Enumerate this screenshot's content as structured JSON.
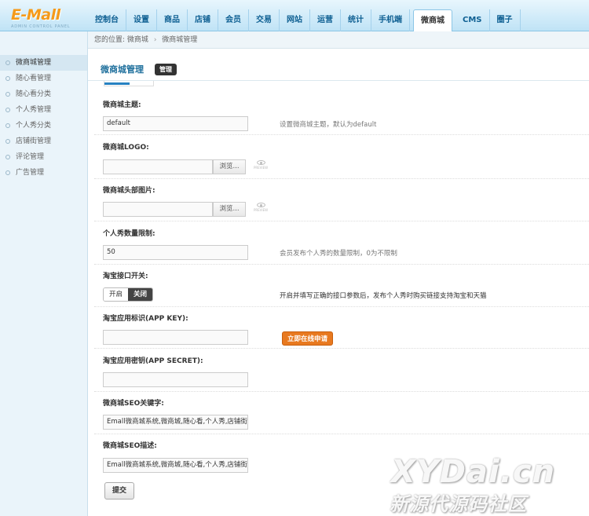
{
  "brand": {
    "logo": "E-Mall",
    "tagline": "ADMIN CONTROL PANEL"
  },
  "nav": {
    "items": [
      "控制台",
      "设置",
      "商品",
      "店铺",
      "会员",
      "交易",
      "网站",
      "运营",
      "统计",
      "手机端",
      "微商城",
      "CMS",
      "圈子"
    ],
    "active": "微商城"
  },
  "breadcrumb": {
    "prefix": "您的位置:",
    "level1": "微商城",
    "separator": "›",
    "level2": "微商城管理"
  },
  "sidebar": {
    "items": [
      {
        "label": "微商城管理",
        "active": true
      },
      {
        "label": "随心看管理"
      },
      {
        "label": "随心看分类"
      },
      {
        "label": "个人秀管理"
      },
      {
        "label": "个人秀分类"
      },
      {
        "label": "店铺街管理"
      },
      {
        "label": "评论管理"
      },
      {
        "label": "广告管理"
      }
    ]
  },
  "page": {
    "title": "微商城管理",
    "tab": "管理"
  },
  "form": {
    "theme": {
      "label": "微商城主题:",
      "value": "default",
      "tip": "设置微商城主题，默认为default"
    },
    "logo": {
      "label": "微商城LOGO:",
      "browse": "浏览...",
      "preview": "PREVIEW"
    },
    "header_image": {
      "label": "微商城头部图片:",
      "browse": "浏览...",
      "preview": "PREVIEW"
    },
    "show_limit": {
      "label": "个人秀数量限制:",
      "value": "50",
      "tip": "会员发布个人秀的数量限制，0为不限制"
    },
    "taobao_switch": {
      "label": "淘宝接口开关:",
      "on_label": "开启",
      "off_label": "关闭",
      "selected": "关闭",
      "tip": "开启并填写正确的接口参数后，发布个人秀时购买链接支持淘宝和天猫"
    },
    "app_key": {
      "label": "淘宝应用标识(APP KEY):",
      "value": "",
      "apply": "立即在线申请"
    },
    "app_secret": {
      "label": "淘宝应用密钥(APP SECRET):",
      "value": ""
    },
    "seo_keywords": {
      "label": "微商城SEO关键字:",
      "value": "Emall微商城系统,微商城,随心看,个人秀,店铺街,"
    },
    "seo_description": {
      "label": "微商城SEO描述:",
      "value": "Emall微商城系统,微商城,随心看,个人秀,店铺街"
    },
    "submit": "提交"
  },
  "watermark": {
    "main": "XYDai.cn",
    "sub": "新源代源码社区"
  }
}
